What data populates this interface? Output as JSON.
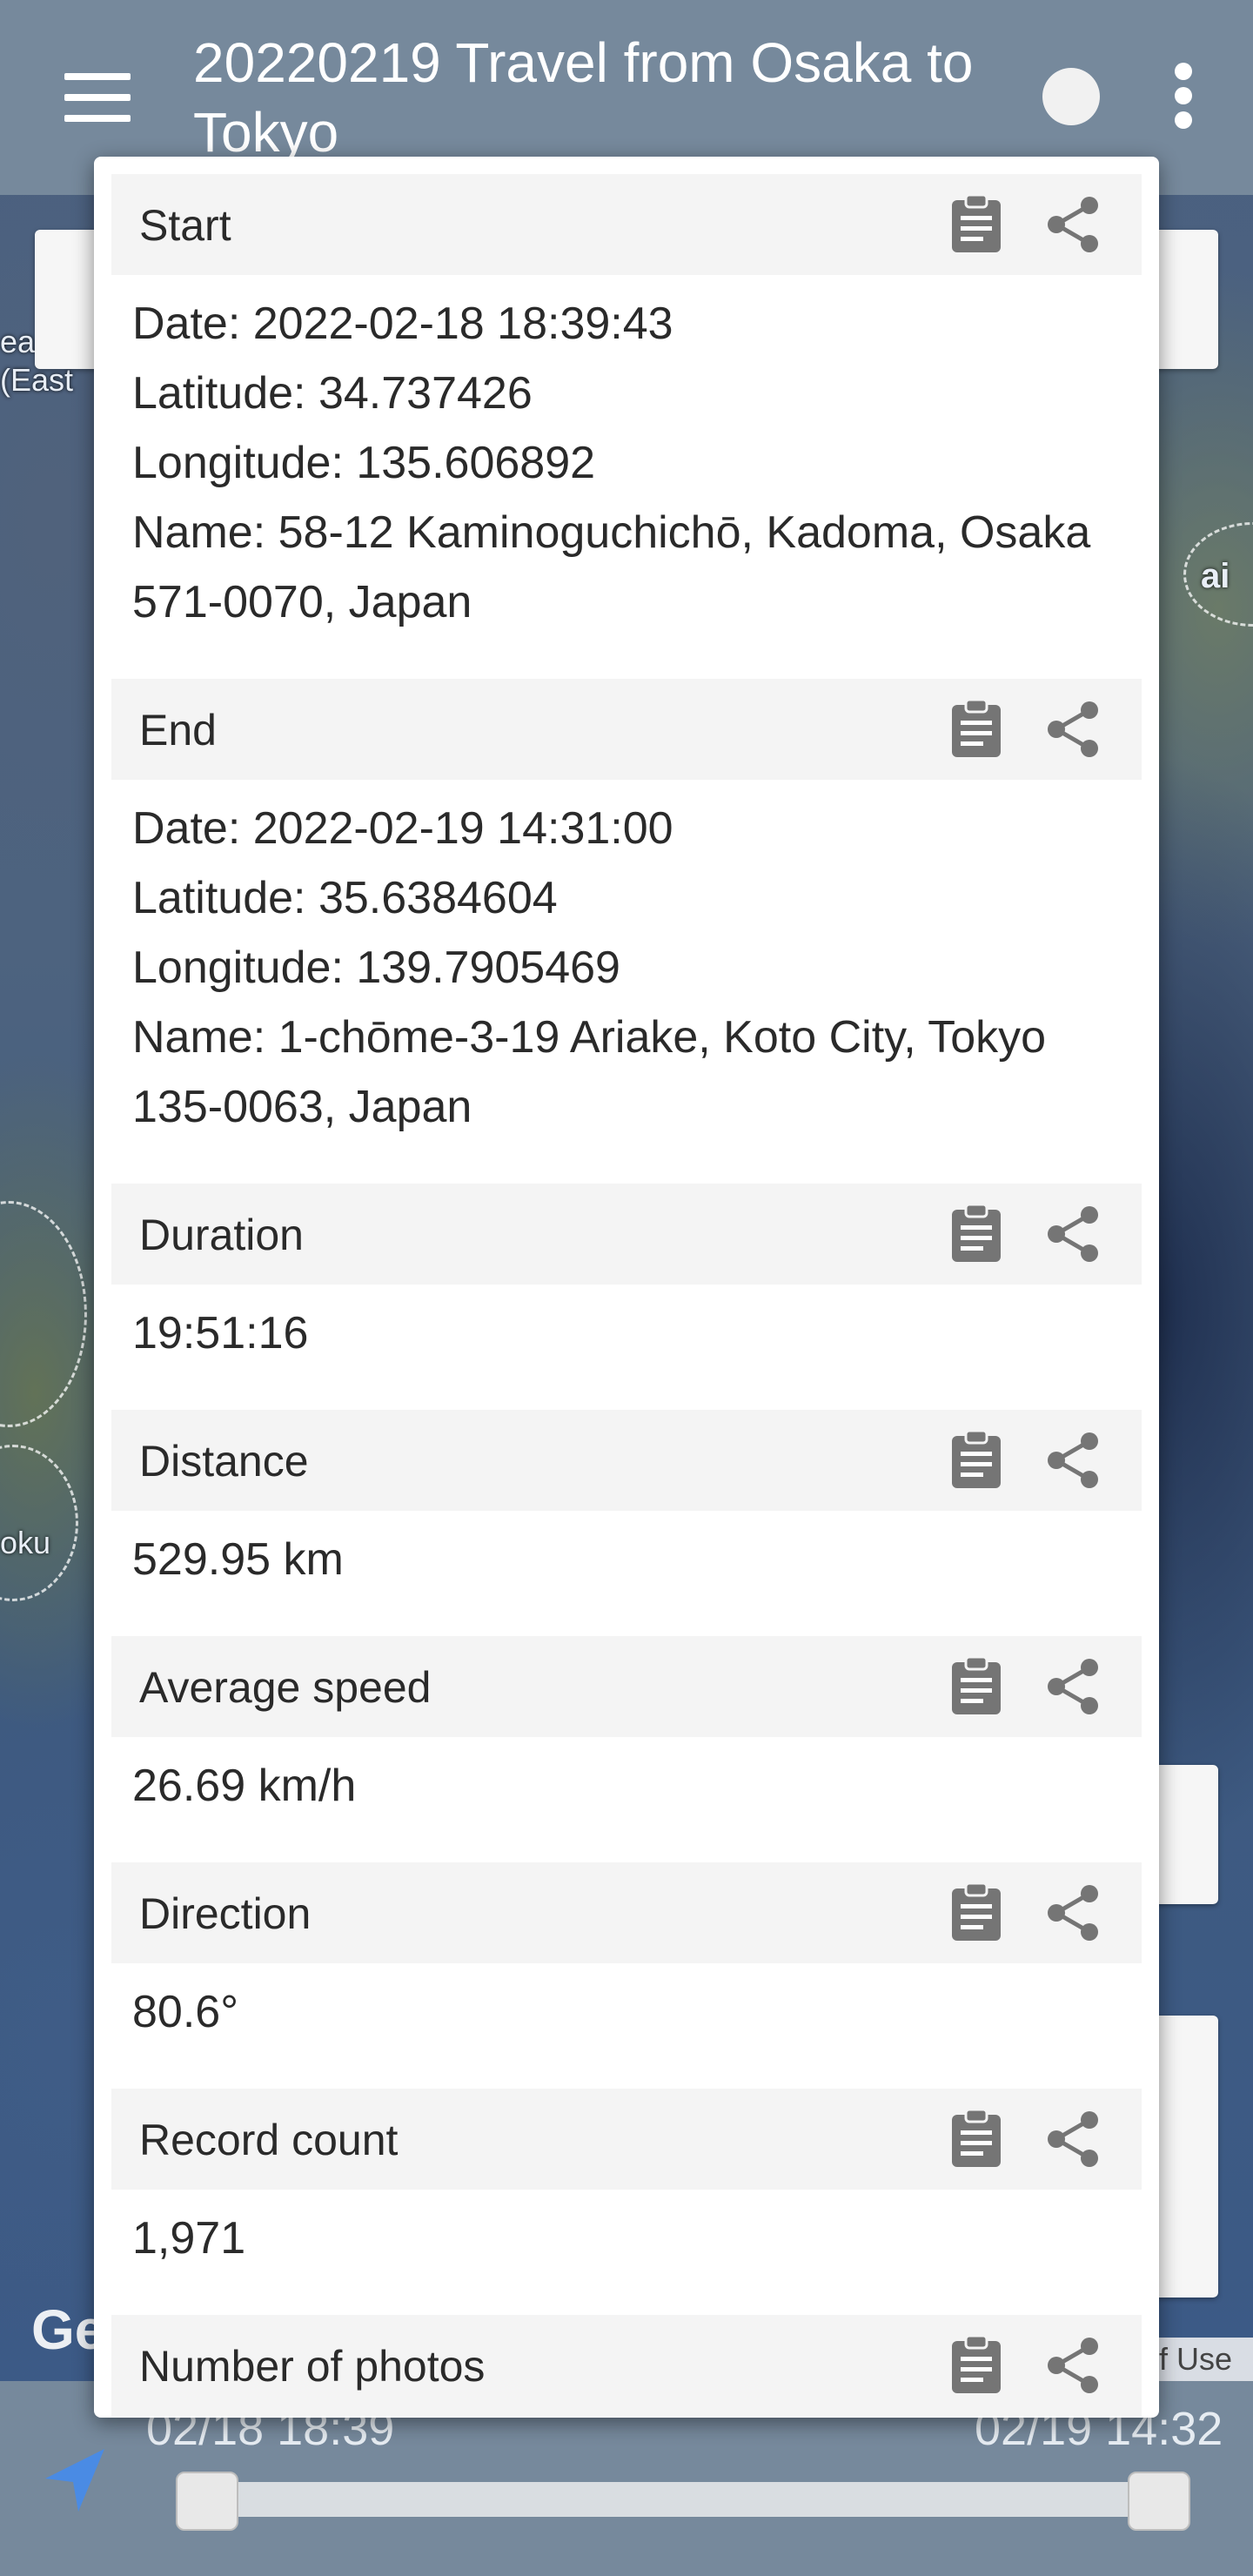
{
  "app_bar": {
    "title": "20220219 Travel from Osaka to Tokyo",
    "menu_icon": "hamburger-menu-icon",
    "status_icon": "circle-status-icon",
    "overflow_icon": "more-vert-icon"
  },
  "map": {
    "labels": [
      "ea",
      "(East",
      "ai",
      "oku"
    ],
    "attribution": "Ge",
    "terms": "f Use"
  },
  "dialog": {
    "sections": [
      {
        "title": "Start",
        "lines": [
          "Date: 2022-02-18 18:39:43",
          "Latitude: 34.737426",
          "Longitude: 135.606892",
          "Name: 58-12 Kaminoguchichō, Kadoma, Osaka 571-0070, Japan"
        ]
      },
      {
        "title": "End",
        "lines": [
          "Date: 2022-02-19 14:31:00",
          "Latitude: 35.6384604",
          "Longitude: 139.7905469",
          "Name: 1-chōme-3-19 Ariake, Koto City, Tokyo 135-0063, Japan"
        ]
      },
      {
        "title": "Duration",
        "lines": [
          "19:51:16"
        ]
      },
      {
        "title": "Distance",
        "lines": [
          "529.95 km"
        ]
      },
      {
        "title": "Average speed",
        "lines": [
          "26.69 km/h"
        ]
      },
      {
        "title": "Direction",
        "lines": [
          "80.6°"
        ]
      },
      {
        "title": "Record count",
        "lines": [
          "1,971"
        ]
      },
      {
        "title": "Number of photos",
        "lines": []
      }
    ],
    "copy_icon": "clipboard-icon",
    "share_icon": "share-icon"
  },
  "bottom_bar": {
    "start_time": "02/18 18:39",
    "end_time": "02/19 14:32",
    "nav_icon": "navigation-arrow-icon"
  },
  "colors": {
    "app_bar": "#76899c",
    "section_header": "#f4f4f4",
    "icon_gray": "#757575"
  }
}
